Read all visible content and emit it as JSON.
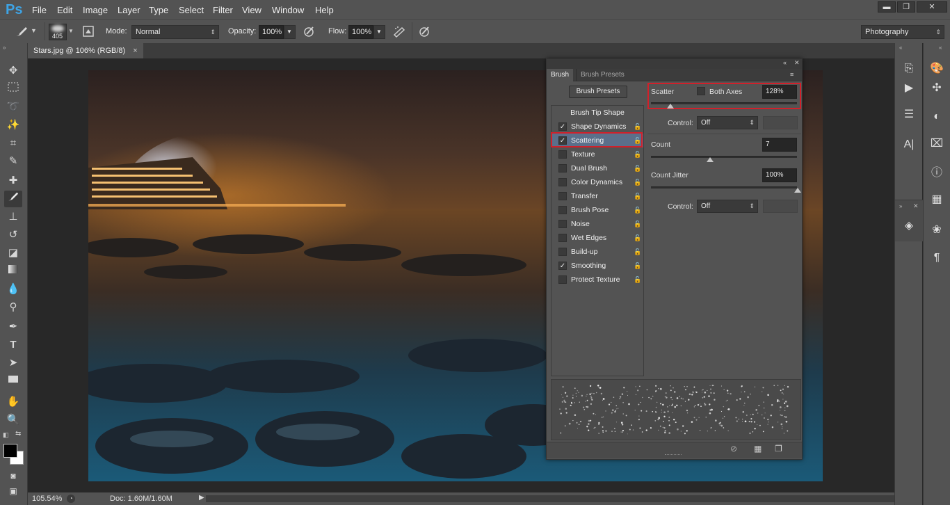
{
  "app": {
    "logo": "Ps"
  },
  "menu": [
    "File",
    "Edit",
    "Image",
    "Layer",
    "Type",
    "Select",
    "Filter",
    "View",
    "Window",
    "Help"
  ],
  "window_controls": {
    "minimize": "▬",
    "restore": "❐",
    "close": "✕"
  },
  "options_bar": {
    "brush_size": "405",
    "mode_label": "Mode:",
    "mode_value": "Normal",
    "opacity_label": "Opacity:",
    "opacity_value": "100%",
    "flow_label": "Flow:",
    "flow_value": "100%",
    "workspace_value": "Photography"
  },
  "document": {
    "tab_title": "Stars.jpg @ 106% (RGB/8)",
    "tab_close": "×"
  },
  "status": {
    "zoom": "105.54%",
    "doc_info": "Doc: 1.60M/1.60M"
  },
  "brush_panel": {
    "tabs": [
      "Brush",
      "Brush Presets"
    ],
    "presets_button": "Brush Presets",
    "tip_shape": "Brush Tip Shape",
    "items": [
      {
        "label": "Shape Dynamics",
        "checked": true
      },
      {
        "label": "Scattering",
        "checked": true
      },
      {
        "label": "Texture",
        "checked": false
      },
      {
        "label": "Dual Brush",
        "checked": false
      },
      {
        "label": "Color Dynamics",
        "checked": false
      },
      {
        "label": "Transfer",
        "checked": false
      },
      {
        "label": "Brush Pose",
        "checked": false
      },
      {
        "label": "Noise",
        "checked": false
      },
      {
        "label": "Wet Edges",
        "checked": false
      },
      {
        "label": "Build-up",
        "checked": false
      },
      {
        "label": "Smoothing",
        "checked": true
      },
      {
        "label": "Protect Texture",
        "checked": false
      }
    ],
    "scatter_label": "Scatter",
    "both_axes_label": "Both Axes",
    "scatter_value": "128%",
    "control_label": "Control:",
    "control_value": "Off",
    "count_label": "Count",
    "count_value": "7",
    "count_jitter_label": "Count Jitter",
    "count_jitter_value": "100%",
    "control2_label": "Control:",
    "control2_value": "Off"
  },
  "colors": {
    "panel_bg": "#535353",
    "highlight_red": "#d1202a",
    "selected_item": "#5b6f8a",
    "ps_blue": "#3ea4e6"
  }
}
